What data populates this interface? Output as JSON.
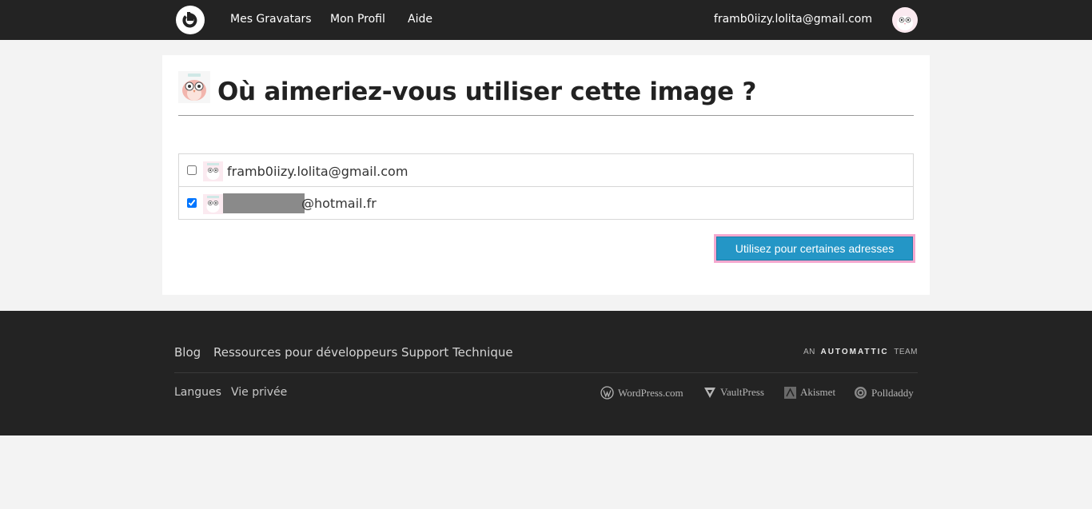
{
  "header": {
    "nav": [
      {
        "label": "Mes Gravatars"
      },
      {
        "label": "Mon Profil"
      },
      {
        "label": "Aide"
      }
    ],
    "user_email": "framb0iizy.lolita@gmail.com"
  },
  "main": {
    "title": "Où aimeriez-vous utiliser cette image ?",
    "addresses": [
      {
        "email": "framb0iizy.lolita@gmail.com",
        "checked": false
      },
      {
        "email_visible_suffix": "@hotmail.fr",
        "checked": true
      }
    ],
    "submit_label": "Utilisez pour certaines adresses"
  },
  "footer": {
    "primary_links": [
      {
        "label": "Blog"
      },
      {
        "label": "Ressources pour développeurs"
      },
      {
        "label": "Support Technique"
      }
    ],
    "automattic_prefix": "AN",
    "automattic_name": "AUTOMATTIC",
    "automattic_suffix": "TEAM",
    "secondary_links": [
      {
        "label": "Langues"
      },
      {
        "label": "Vie privée"
      }
    ],
    "brands": [
      {
        "label": "WordPress.com",
        "icon": "wordpress-icon"
      },
      {
        "label": "VaultPress",
        "icon": "vaultpress-icon"
      },
      {
        "label": "Akismet",
        "icon": "akismet-icon"
      },
      {
        "label": "Polldaddy",
        "icon": "polldaddy-icon"
      }
    ]
  },
  "colors": {
    "topbar": "#232323",
    "accent_button": "#2496c6",
    "button_highlight": "#f5a8cf"
  }
}
